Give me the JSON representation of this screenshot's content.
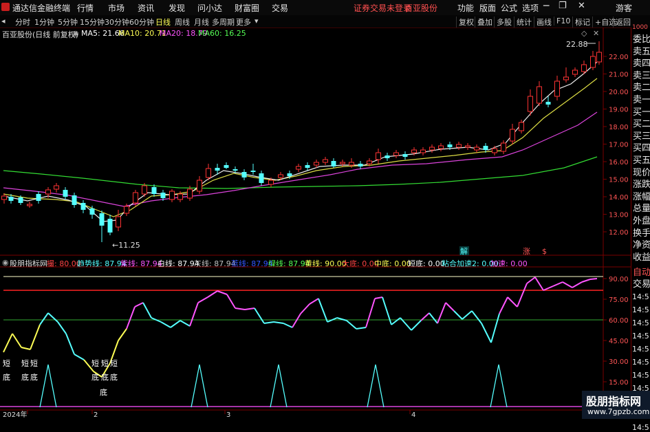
{
  "menubar": {
    "app_title": "通达信金融终端",
    "items": [
      "行情",
      "市场",
      "资讯",
      "发现",
      "问小达",
      "财富圈",
      "交易"
    ],
    "notice": "证券交易未登录",
    "stock": "百亚股份",
    "right_items": [
      "功能",
      "版面",
      "公式",
      "选项"
    ],
    "guest": "游客"
  },
  "toolbar": {
    "periods": [
      "分时",
      "1分钟",
      "5分钟",
      "15分钟",
      "30分钟",
      "60分钟",
      "日线",
      "周线",
      "月线",
      "多周期",
      "更多"
    ],
    "active_period": "日线",
    "buttons": [
      "复权",
      "叠加",
      "多股",
      "统计",
      "画线",
      "F10",
      "标记",
      "+自选",
      "返回"
    ]
  },
  "main_chart": {
    "title": "百亚股份(日线 前复权)",
    "ma": [
      {
        "label": "MA5: 21.66",
        "color": "#ffffff"
      },
      {
        "label": "MA10: 20.71",
        "color": "#ffff55"
      },
      {
        "label": "MA20: 18.79",
        "color": "#ff55ff"
      },
      {
        "label": "MA60: 16.25",
        "color": "#55ff55"
      }
    ],
    "high_label": "22.88",
    "low_label": "←11.25",
    "yticks": [
      "22.00",
      "21.00",
      "20.00",
      "19.00",
      "18.00",
      "17.00",
      "16.00",
      "15.00",
      "14.00",
      "13.00",
      "12.00"
    ],
    "markers": [
      {
        "text": "解",
        "color": "#55ffff"
      },
      {
        "text": "涨",
        "color": "#ff5555"
      },
      {
        "text": "$",
        "color": "#ff5555"
      }
    ]
  },
  "indicator": {
    "name": "股朋指标网",
    "values": [
      {
        "label": "撮: 80.00",
        "color": "#ff4444"
      },
      {
        "label": "趋势线: 87.94",
        "color": "#55ffff"
      },
      {
        "label": "紫线: 87.94",
        "color": "#ff55ff"
      },
      {
        "label": "白线: 87.94",
        "color": "#ffffff"
      },
      {
        "label": "灰线: 87.94",
        "color": "#c0c0c0"
      },
      {
        "label": "蓝线: 87.94",
        "color": "#3355ff"
      },
      {
        "label": "绿线: 87.94",
        "color": "#55ff55"
      },
      {
        "label": "黄线: 90.00",
        "color": "#ffff55"
      },
      {
        "label": "大底: 0.00",
        "color": "#ff4444"
      },
      {
        "label": "中底: 0.00",
        "color": "#ffff55"
      },
      {
        "label": "短底: 0.00",
        "color": "#ffffff"
      },
      {
        "label": "粘合加速2: 0.00",
        "color": "#55ffff"
      },
      {
        "label": "加速: 0.00",
        "color": "#ff55ff"
      }
    ],
    "yticks": [
      "90.00",
      "75.00",
      "60.00",
      "45.00",
      "30.00",
      "15.00"
    ],
    "signal_text_short": "短",
    "signal_text_bottom": "底"
  },
  "xaxis": [
    "2024年",
    "2",
    "3",
    "4"
  ],
  "right_panel": {
    "top_label": "1000",
    "items": [
      "委比",
      "卖五",
      "卖四",
      "卖三",
      "卖二",
      "卖一",
      "买一",
      "买二",
      "买三",
      "买四",
      "买五",
      "现价",
      "涨跌",
      "涨幅",
      "总量",
      "外盘",
      "换手",
      "净资",
      "收益"
    ],
    "bottom_items": [
      "自动",
      "交易"
    ],
    "times": [
      "14:5",
      "14:5",
      "14:5",
      "14:5",
      "14:5",
      "14:5",
      "14:5",
      "14:5",
      "14:5",
      "14:5",
      "14:5"
    ]
  },
  "watermark": {
    "title": "股朋指标网",
    "url": "www.7gpzb.com"
  },
  "colors": {
    "up": "#ff3333",
    "down": "#55ffff",
    "grid": "#7a0000"
  }
}
